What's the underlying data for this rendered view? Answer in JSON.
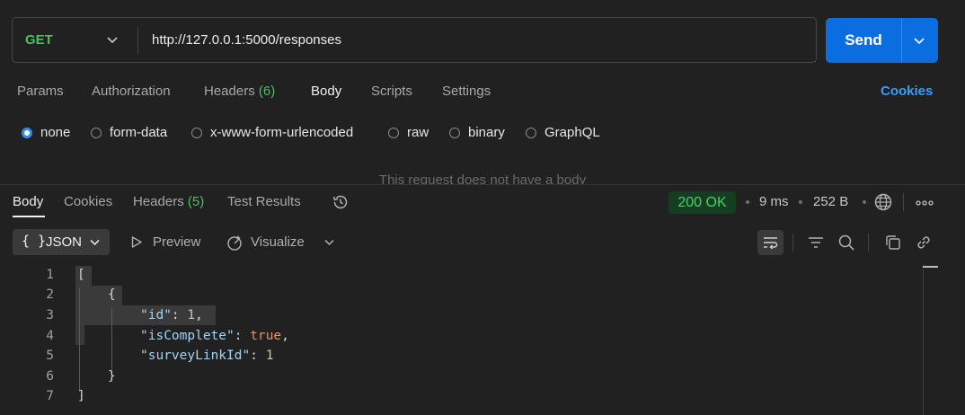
{
  "request": {
    "method": "GET",
    "url": "http://127.0.0.1:5000/responses",
    "send_label": "Send"
  },
  "request_tabs": {
    "params": "Params",
    "authorization": "Authorization",
    "headers": "Headers",
    "headers_count": "(6)",
    "body": "Body",
    "scripts": "Scripts",
    "settings": "Settings",
    "cookies": "Cookies",
    "active": "Body"
  },
  "body_types": {
    "none": "none",
    "form_data": "form-data",
    "urlencoded": "x-www-form-urlencoded",
    "raw": "raw",
    "binary": "binary",
    "graphql": "GraphQL",
    "selected": "none"
  },
  "no_body_message": "This request does not have a body",
  "response_tabs": {
    "body": "Body",
    "cookies": "Cookies",
    "headers": "Headers",
    "headers_count": "(5)",
    "test_results": "Test Results",
    "active": "Body"
  },
  "response_meta": {
    "status": "200 OK",
    "time": "9 ms",
    "size": "252 B"
  },
  "response_toolbar": {
    "format_icon": "{ }",
    "format": "JSON",
    "preview": "Preview",
    "visualize": "Visualize"
  },
  "code_lines": [
    {
      "n": "1",
      "text": "["
    },
    {
      "n": "2",
      "text": "{"
    },
    {
      "n": "3",
      "key": "\"id\"",
      "sep": ": ",
      "value": "1",
      "tail": ","
    },
    {
      "n": "4",
      "key": "\"isComplete\"",
      "sep": ": ",
      "value": "true",
      "tail": ","
    },
    {
      "n": "5",
      "key": "\"surveyLinkId\"",
      "sep": ": ",
      "value": "1",
      "tail": ""
    },
    {
      "n": "6",
      "text": "}"
    },
    {
      "n": "7",
      "text": "]"
    }
  ],
  "colors": {
    "accent": "#0b6ee0",
    "method_green": "#4fbd66",
    "status_bg": "#153d20",
    "link_blue": "#3e9cf7"
  },
  "icons": {
    "method_dropdown": "chevron-down-icon",
    "send_dropdown": "chevron-down-icon",
    "history": "history-icon",
    "globe": "globe-icon",
    "more": "more-horizontal-icon",
    "preview": "play-icon",
    "visualize": "visualize-icon",
    "wrap": "wrap-lines-icon",
    "filter": "filter-icon",
    "search": "search-icon",
    "copy": "copy-icon",
    "link": "link-icon"
  }
}
